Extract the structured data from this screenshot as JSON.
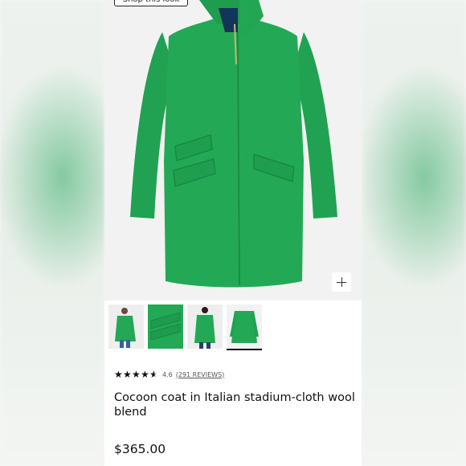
{
  "hero": {
    "shop_look_label": "Shop this look",
    "zoom_icon": "plus-icon",
    "coat_color": "#21a654"
  },
  "thumbnails": [
    {
      "name": "model-front-view"
    },
    {
      "name": "fabric-detail-view"
    },
    {
      "name": "model-back-view"
    },
    {
      "name": "flat-product-view",
      "selected": true
    }
  ],
  "product": {
    "rating_value": "4.6",
    "reviews_label": "(291 REVIEWS)",
    "stars": 4.6,
    "title": "Cocoon coat in Italian stadium-cloth wool blend",
    "price": "$365.00"
  }
}
